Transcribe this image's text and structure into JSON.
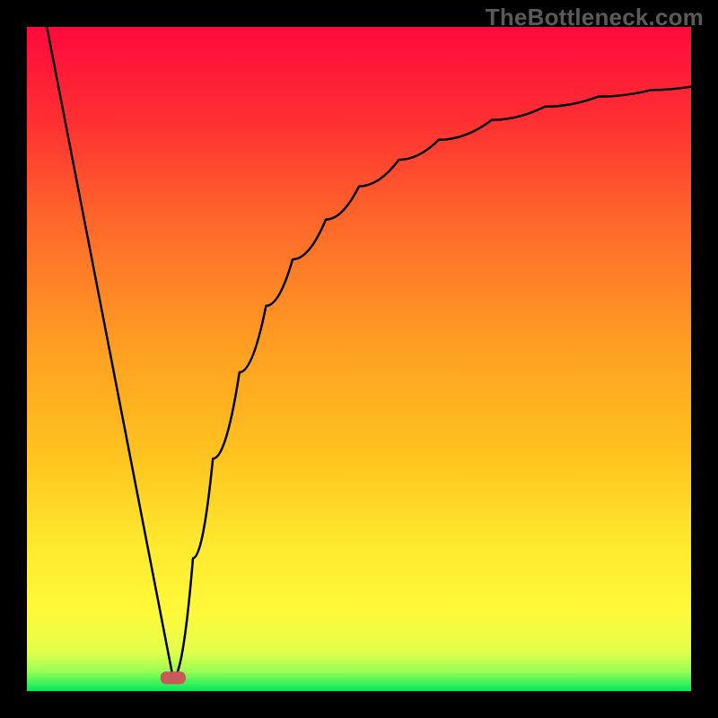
{
  "watermark": "TheBottleneck.com",
  "chart_data": {
    "type": "line",
    "title": "",
    "xlabel": "",
    "ylabel": "",
    "xlim": [
      0,
      100
    ],
    "ylim": [
      0,
      100
    ],
    "grid": false,
    "legend": false,
    "background_gradient": {
      "top_color": "#ff0a3c",
      "mid_colors": [
        "#ff6a2a",
        "#ffc21f",
        "#fff93a"
      ],
      "bottom_color": "#00e85e"
    },
    "marker": {
      "x": 22,
      "y": 2,
      "color": "#c85a5a",
      "shape": "rounded-rect"
    },
    "series": [
      {
        "name": "left-branch",
        "x": [
          3,
          22
        ],
        "y": [
          100,
          2
        ],
        "style": "straight"
      },
      {
        "name": "right-branch",
        "x": [
          22,
          25,
          28,
          32,
          36,
          40,
          45,
          50,
          56,
          62,
          70,
          78,
          86,
          94,
          100
        ],
        "y": [
          2,
          20,
          35,
          48,
          58,
          65,
          71,
          76,
          80,
          83,
          86,
          88,
          89.5,
          90.5,
          91
        ],
        "style": "curve"
      }
    ]
  }
}
